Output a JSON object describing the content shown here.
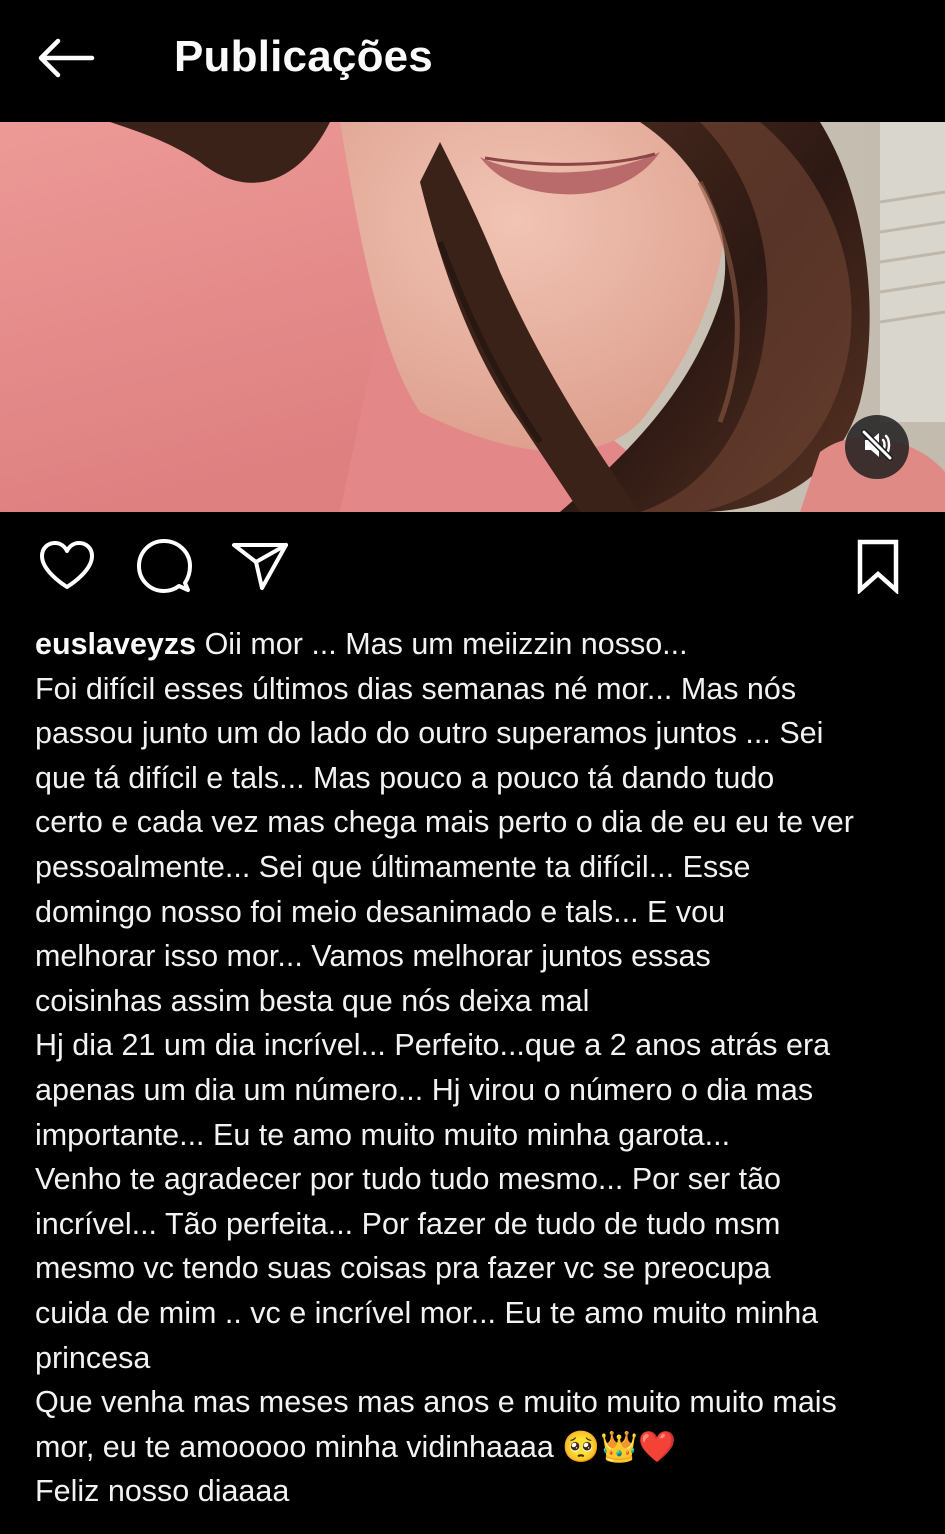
{
  "header": {
    "title": "Publicações",
    "back_icon": "arrow-left-icon"
  },
  "media": {
    "type": "video",
    "audio_state": "muted",
    "mute_icon": "speaker-muted-icon",
    "colors": {
      "shirt": "#e58a8a",
      "skin": "#e9b3a3",
      "hair": "#3b2218",
      "background": "#c9c2b4"
    }
  },
  "actions": {
    "like_icon": "heart-icon",
    "comment_icon": "comment-icon",
    "share_icon": "paper-plane-icon",
    "save_icon": "bookmark-icon"
  },
  "post": {
    "username": "euslaveyzs",
    "caption_lines": [
      "Oii mor ... Mas um meiizzin nosso...",
      "Foi difícil esses últimos dias semanas né mor... Mas nós",
      "passou junto um do lado do outro superamos juntos ... Sei",
      "que tá difícil e tals... Mas pouco a pouco tá dando tudo",
      "certo e cada vez mas chega mais perto o dia de eu eu te ver",
      "pessoalmente... Sei que últimamente ta difícil... Esse",
      "domingo nosso foi meio desanimado e tals... E vou",
      "melhorar isso mor... Vamos melhorar juntos essas",
      "coisinhas assim besta que nós deixa mal",
      "Hj dia 21 um dia incrível... Perfeito...que a 2 anos atrás era",
      "apenas um dia um número... Hj virou o número o dia mas",
      "importante... Eu te amo muito muito minha garota...",
      "Venho te agradecer por tudo tudo mesmo... Por ser tão",
      "incrível... Tão perfeita... Por fazer de tudo de tudo msm",
      "mesmo vc tendo suas coisas pra fazer vc se preocupa",
      "cuida de mim .. vc e incrível mor... Eu te amo muito minha",
      "princesa",
      "Que venha mas meses mas anos e muito muito muito mais",
      "mor, eu te amooooo minha vidinhaaaa 🥺👑❤️",
      "Feliz nosso diaaaa"
    ]
  }
}
